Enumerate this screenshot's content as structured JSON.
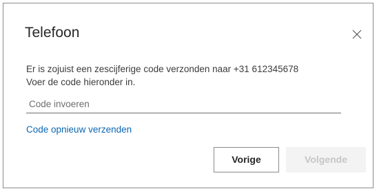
{
  "dialog": {
    "title": "Telefoon",
    "close_icon": "close-icon",
    "message_line1": "Er is zojuist een zescijferige code verzonden naar +31 612345678",
    "message_line2": "Voer de code hieronder in.",
    "code_input": {
      "placeholder": "Code invoeren",
      "value": ""
    },
    "resend_link": "Code opnieuw verzenden",
    "back_button": "Vorige",
    "next_button": "Volgende"
  },
  "colors": {
    "link": "#0b66b2",
    "border": "#8a8a8a",
    "disabled_bg": "#f3f3f3",
    "disabled_text": "#c6c6c6"
  }
}
